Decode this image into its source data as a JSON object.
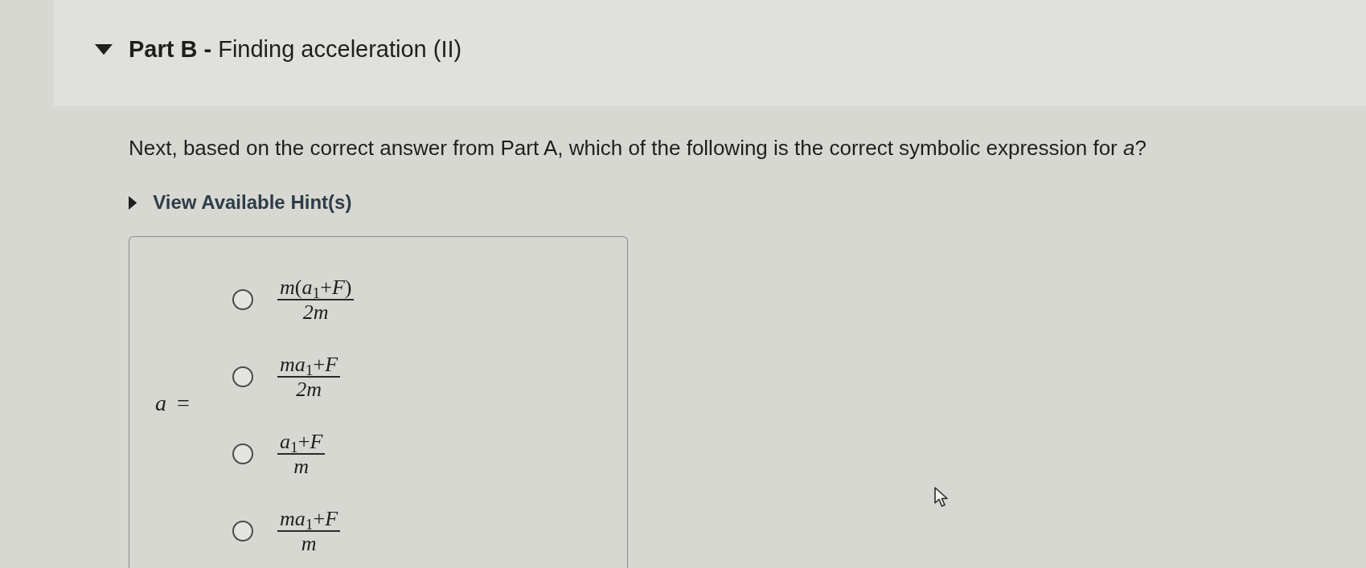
{
  "part": {
    "title": "**Part B -** Finding acceleration (II)",
    "expanded": true
  },
  "question": "Next, based on the correct answer from Part A, which of the following is the correct symbolic expression for *a*?",
  "hints": {
    "label": "View Available Hint(s)",
    "expanded": false
  },
  "answer": {
    "lhs": "*a* =",
    "options": [
      {
        "numerator": "*m*(*a*$_{1}$+*F*)",
        "denominator": "2m",
        "selected": false
      },
      {
        "numerator": "*ma*$_{1}$+*F*",
        "denominator": "2m",
        "selected": false
      },
      {
        "numerator": "*a*$_{1}$+*F*",
        "denominator": "m",
        "selected": false
      },
      {
        "numerator": "*ma*$_{1}$+*F*",
        "denominator": "m",
        "selected": false
      }
    ]
  }
}
